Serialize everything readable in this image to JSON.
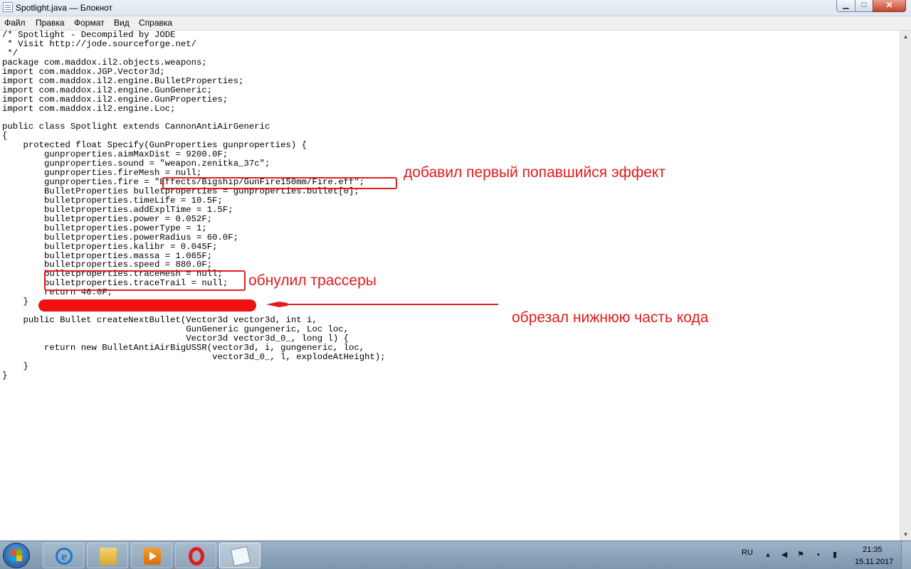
{
  "window": {
    "title": "Spotlight.java — Блокнот"
  },
  "controls": {
    "minimize_glyph": "▁",
    "maximize_glyph": "□",
    "close_glyph": "✕"
  },
  "menu": [
    "Файл",
    "Правка",
    "Формат",
    "Вид",
    "Справка"
  ],
  "code_lines": [
    "/* Spotlight - Decompiled by JODE",
    " * Visit http://jode.sourceforge.net/",
    " */",
    "package com.maddox.il2.objects.weapons;",
    "import com.maddox.JGP.Vector3d;",
    "import com.maddox.il2.engine.BulletProperties;",
    "import com.maddox.il2.engine.GunGeneric;",
    "import com.maddox.il2.engine.GunProperties;",
    "import com.maddox.il2.engine.Loc;",
    "",
    "public class Spotlight extends CannonAntiAirGeneric",
    "{",
    "    protected float Specify(GunProperties gunproperties) {",
    "        gunproperties.aimMaxDist = 9200.0F;",
    "        gunproperties.sound = \"weapon.zenitka_37c\";",
    "        gunproperties.fireMesh = null;",
    "        gunproperties.fire = \"Effects/Bigship/GunFire150mm/Fire.eff\";",
    "        BulletProperties bulletproperties = gunproperties.bullet[0];",
    "        bulletproperties.timeLife = 10.5F;",
    "        bulletproperties.addExplTime = 1.5F;",
    "        bulletproperties.power = 0.052F;",
    "        bulletproperties.powerType = 1;",
    "        bulletproperties.powerRadius = 60.0F;",
    "        bulletproperties.kalibr = 0.045F;",
    "        bulletproperties.massa = 1.065F;",
    "        bulletproperties.speed = 880.0F;",
    "        bulletproperties.traceMesh = null;",
    "        bulletproperties.traceTrail = null;",
    "        return 46.0F;",
    "    }",
    "",
    "    public Bullet createNextBullet(Vector3d vector3d, int i,",
    "                                   GunGeneric gungeneric, Loc loc,",
    "                                   Vector3d vector3d_0_, long l) {",
    "        return new BulletAntiAirBigUSSR(vector3d, i, gungeneric, loc,",
    "                                        vector3d_0_, l, explodeAtHeight);",
    "    }",
    "}"
  ],
  "annotations": {
    "fire_note": "добавил первый попавшийся эффект",
    "trace_note": "обнулил трассеры",
    "cut_note": "обрезал нижнюю часть кода",
    "color": "#e21b1b"
  },
  "taskbar": {
    "language": "RU",
    "time": "21:35",
    "date": "15.11.2017",
    "apps": [
      "internet-explorer",
      "windows-explorer",
      "media-player",
      "opera",
      "notepad"
    ],
    "active_app": "notepad"
  }
}
